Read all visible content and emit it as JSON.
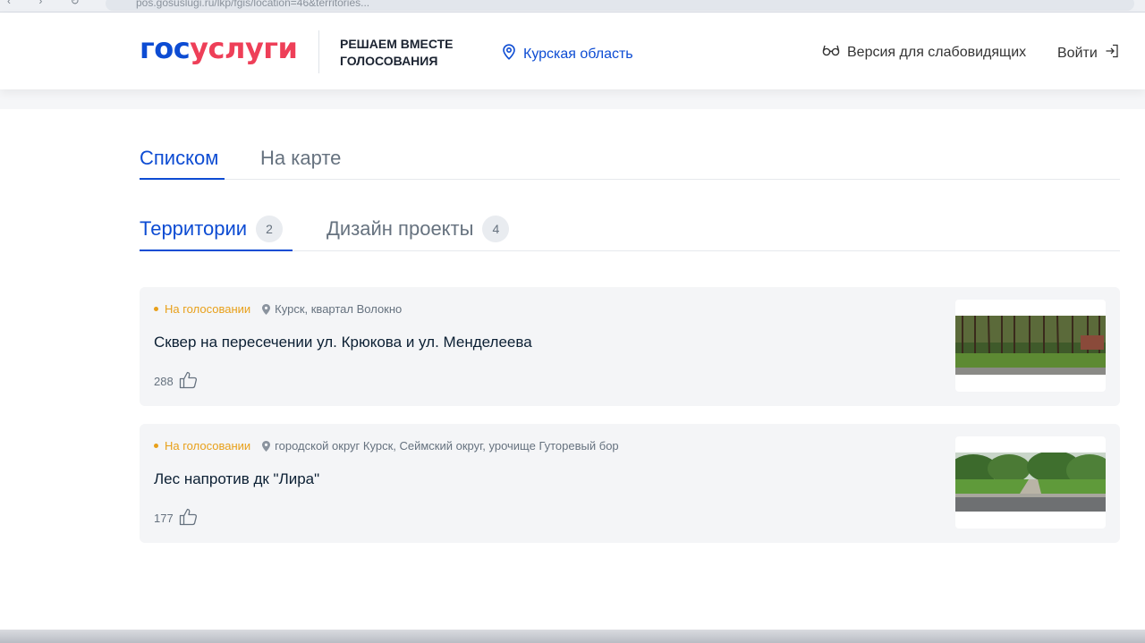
{
  "browser": {
    "url": "pos.gosuslugi.ru/lkp/fgis/location=46&territories..."
  },
  "header": {
    "logo_part1": "гос",
    "logo_part2": "услуги",
    "slogan_line1": "Решаем вместе",
    "slogan_line2": "Голосования",
    "region": "Курская область",
    "accessibility": "Версия для слабовидящих",
    "login": "Войти"
  },
  "view_tabs": [
    {
      "label": "Списком",
      "active": true
    },
    {
      "label": "На карте",
      "active": false
    }
  ],
  "category_tabs": [
    {
      "label": "Территории",
      "count": "2",
      "active": true
    },
    {
      "label": "Дизайн проекты",
      "count": "4",
      "active": false
    }
  ],
  "cards": [
    {
      "status": "На голосовании",
      "location": "Курск, квартал Волокно",
      "title": "Сквер на пересечении ул. Крюкова и ул. Менделеева",
      "votes": "288",
      "thumbnail": "park-photo"
    },
    {
      "status": "На голосовании",
      "location": "городской округ Курск, Сеймский округ, урочище Гуторевый бор",
      "title": "Лес напротив дк \"Лира\"",
      "votes": "177",
      "thumbnail": "forest-photo"
    }
  ],
  "colors": {
    "accent": "#0d4cd3",
    "logo_red": "#ee3f58",
    "status": "#e8a01a",
    "card_bg": "#f4f5f7"
  },
  "icons": {
    "region": "location-pin-icon",
    "accessibility": "glasses-icon",
    "login": "login-arrow-icon",
    "votes": "thumbs-up-icon"
  }
}
